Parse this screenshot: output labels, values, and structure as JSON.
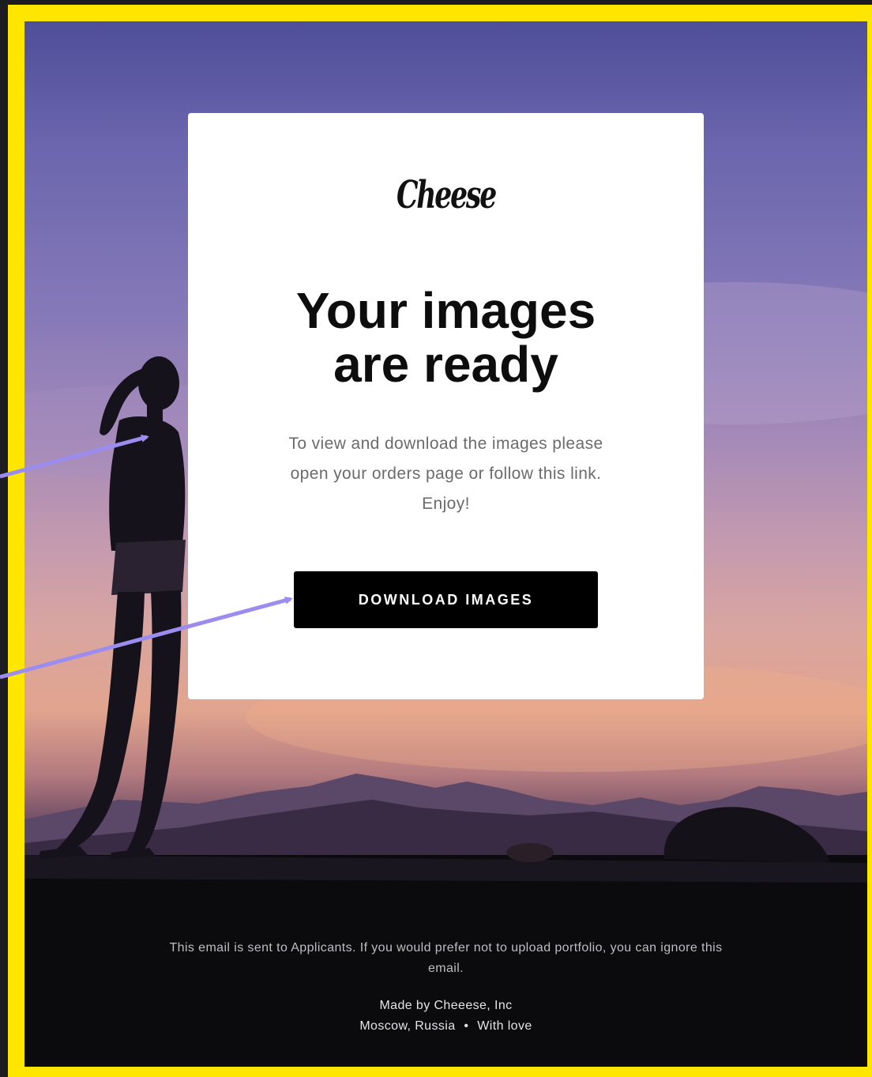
{
  "brand": {
    "logo_text": "Cheese",
    "frame_color": "#ffe600",
    "button_color": "#000000"
  },
  "card": {
    "headline_line1": "Your images",
    "headline_line2": "are ready",
    "body_line1": "To view and download the images please",
    "body_line2": "open your orders page or follow this link.",
    "body_line3": "Enjoy!",
    "button_label": "DOWNLOAD IMAGES"
  },
  "footer": {
    "note": "This email is sent to Applicants. If you would prefer not to upload portfolio, you can ignore this email.",
    "company": "Made by Cheeese, Inc",
    "location": "Moscow, Russia",
    "separator": "•",
    "tagline": "With love"
  },
  "annotations": {
    "arrow_color": "#9b8cf0"
  }
}
